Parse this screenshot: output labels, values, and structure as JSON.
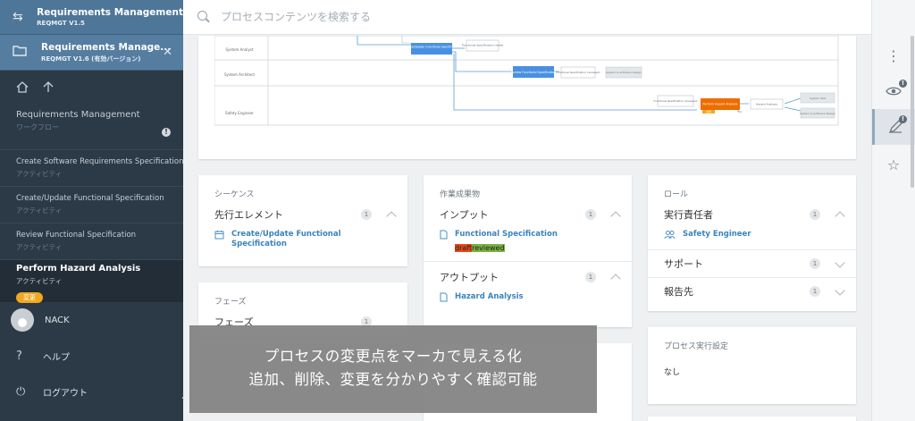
{
  "projects": [
    {
      "name": "Requirements Management",
      "version": "REQMGT V1.5",
      "icon": "swap-arrows-icon"
    },
    {
      "name": "Requirements Manage...",
      "version": "REQMGT V1.6 (有効バージョン)",
      "icon": "folder-icon",
      "close": "✕"
    }
  ],
  "workflow": {
    "title": "Requirements Management",
    "subtitle": "ワークフロー",
    "warn": "!"
  },
  "activities": [
    {
      "title": "Create Software Requirements Specification",
      "type": "アクティビティ"
    },
    {
      "title": "Create/Update Functional Specification",
      "type": "アクティビティ"
    },
    {
      "title": "Review Functional Specification",
      "type": "アクティビティ"
    },
    {
      "title": "Perform Hazard Analysis",
      "type": "アクティビティ",
      "badge": "変更",
      "selected": true
    }
  ],
  "user": {
    "name": "NACK"
  },
  "help": {
    "label": "ヘルプ"
  },
  "logout": {
    "label": "ログアウト"
  },
  "search": {
    "placeholder": "プロセスコンテンツを検索する"
  },
  "diagram": {
    "lanes": [
      "System Analyst",
      "System Architect",
      "Safety Engineer"
    ],
    "nodes": {
      "cu_func": "Create/Update Functional Specification",
      "func_spec": "Functional Specification (draft)",
      "review": "Review Functional Specification",
      "func_spec2": "Functional Specification (reviewed)",
      "sw_design": "System & Software Design",
      "func_spec3": "Functional Specification (reviewed)",
      "hazard": "Perform Hazard Analysis",
      "hazard_out": "Hazard Analysis",
      "sys_test": "System Test",
      "sys_sw_design": "System & Software Design",
      "changed_tag": "変更"
    }
  },
  "sequence": {
    "heading": "シーケンス",
    "row_label": "先行エレメント",
    "count": "1",
    "item": "Create/Update Functional Specification"
  },
  "phase": {
    "heading": "フェーズ",
    "row_label": "フェーズ",
    "count": "1"
  },
  "products": {
    "heading": "作業成果物",
    "input_label": "インプット",
    "input_count": "1",
    "input_item": "Functional Specification",
    "diff_deleted": "draft",
    "diff_added": "reviewed",
    "output_label": "アウトプット",
    "output_count": "1",
    "output_item": "Hazard Analysis"
  },
  "roles": {
    "heading": "ロール",
    "responsible_label": "実行責任者",
    "responsible_count": "1",
    "responsible_item": "Safety Engineer",
    "support_label": "サポート",
    "support_count": "1",
    "report_label": "報告先",
    "report_count": "1"
  },
  "exec": {
    "heading": "プロセス実行設定",
    "value": "なし"
  },
  "overlay": {
    "line1": "プロセスの変更点をマーカで見える化",
    "line2": "追加、削除、変更を分かりやすく確認可能"
  },
  "colors": {
    "sidebar": "#2c3a47",
    "project_bar": "#4e7698",
    "accent_blue": "#3a83bd",
    "changed": "#f0a81e",
    "diff_deleted": "#e64a19",
    "diff_added": "#7cb342",
    "node_blue": "#4a90e2",
    "node_orange": "#ef6c00"
  }
}
